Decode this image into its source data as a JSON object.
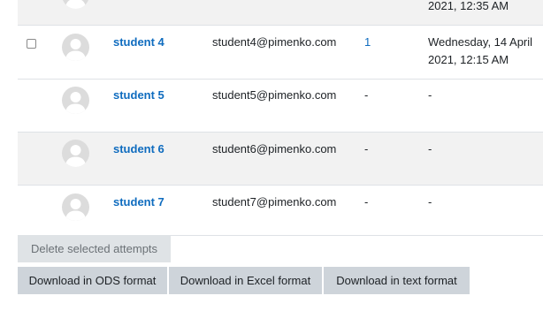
{
  "rows": [
    {
      "name": "",
      "email": "",
      "attempts": "",
      "last_access": "2021, 12:35 AM"
    },
    {
      "name": "student 4",
      "email": "student4@pimenko.com",
      "attempts": "1",
      "last_access_line1": "Wednesday, 14 April",
      "last_access_line2": "2021, 12:15 AM"
    },
    {
      "name": "student 5",
      "email": "student5@pimenko.com",
      "attempts": "-",
      "last_access": "-"
    },
    {
      "name": "student 6",
      "email": "student6@pimenko.com",
      "attempts": "-",
      "last_access": "-"
    },
    {
      "name": "student 7",
      "email": "student7@pimenko.com",
      "attempts": "-",
      "last_access": "-"
    }
  ],
  "buttons": {
    "delete": "Delete selected attempts",
    "ods": "Download in ODS format",
    "excel": "Download in Excel format",
    "text": "Download in text format"
  },
  "colors": {
    "link": "#0f6cbf",
    "stripe": "#f2f2f2",
    "button": "#ced4da"
  }
}
